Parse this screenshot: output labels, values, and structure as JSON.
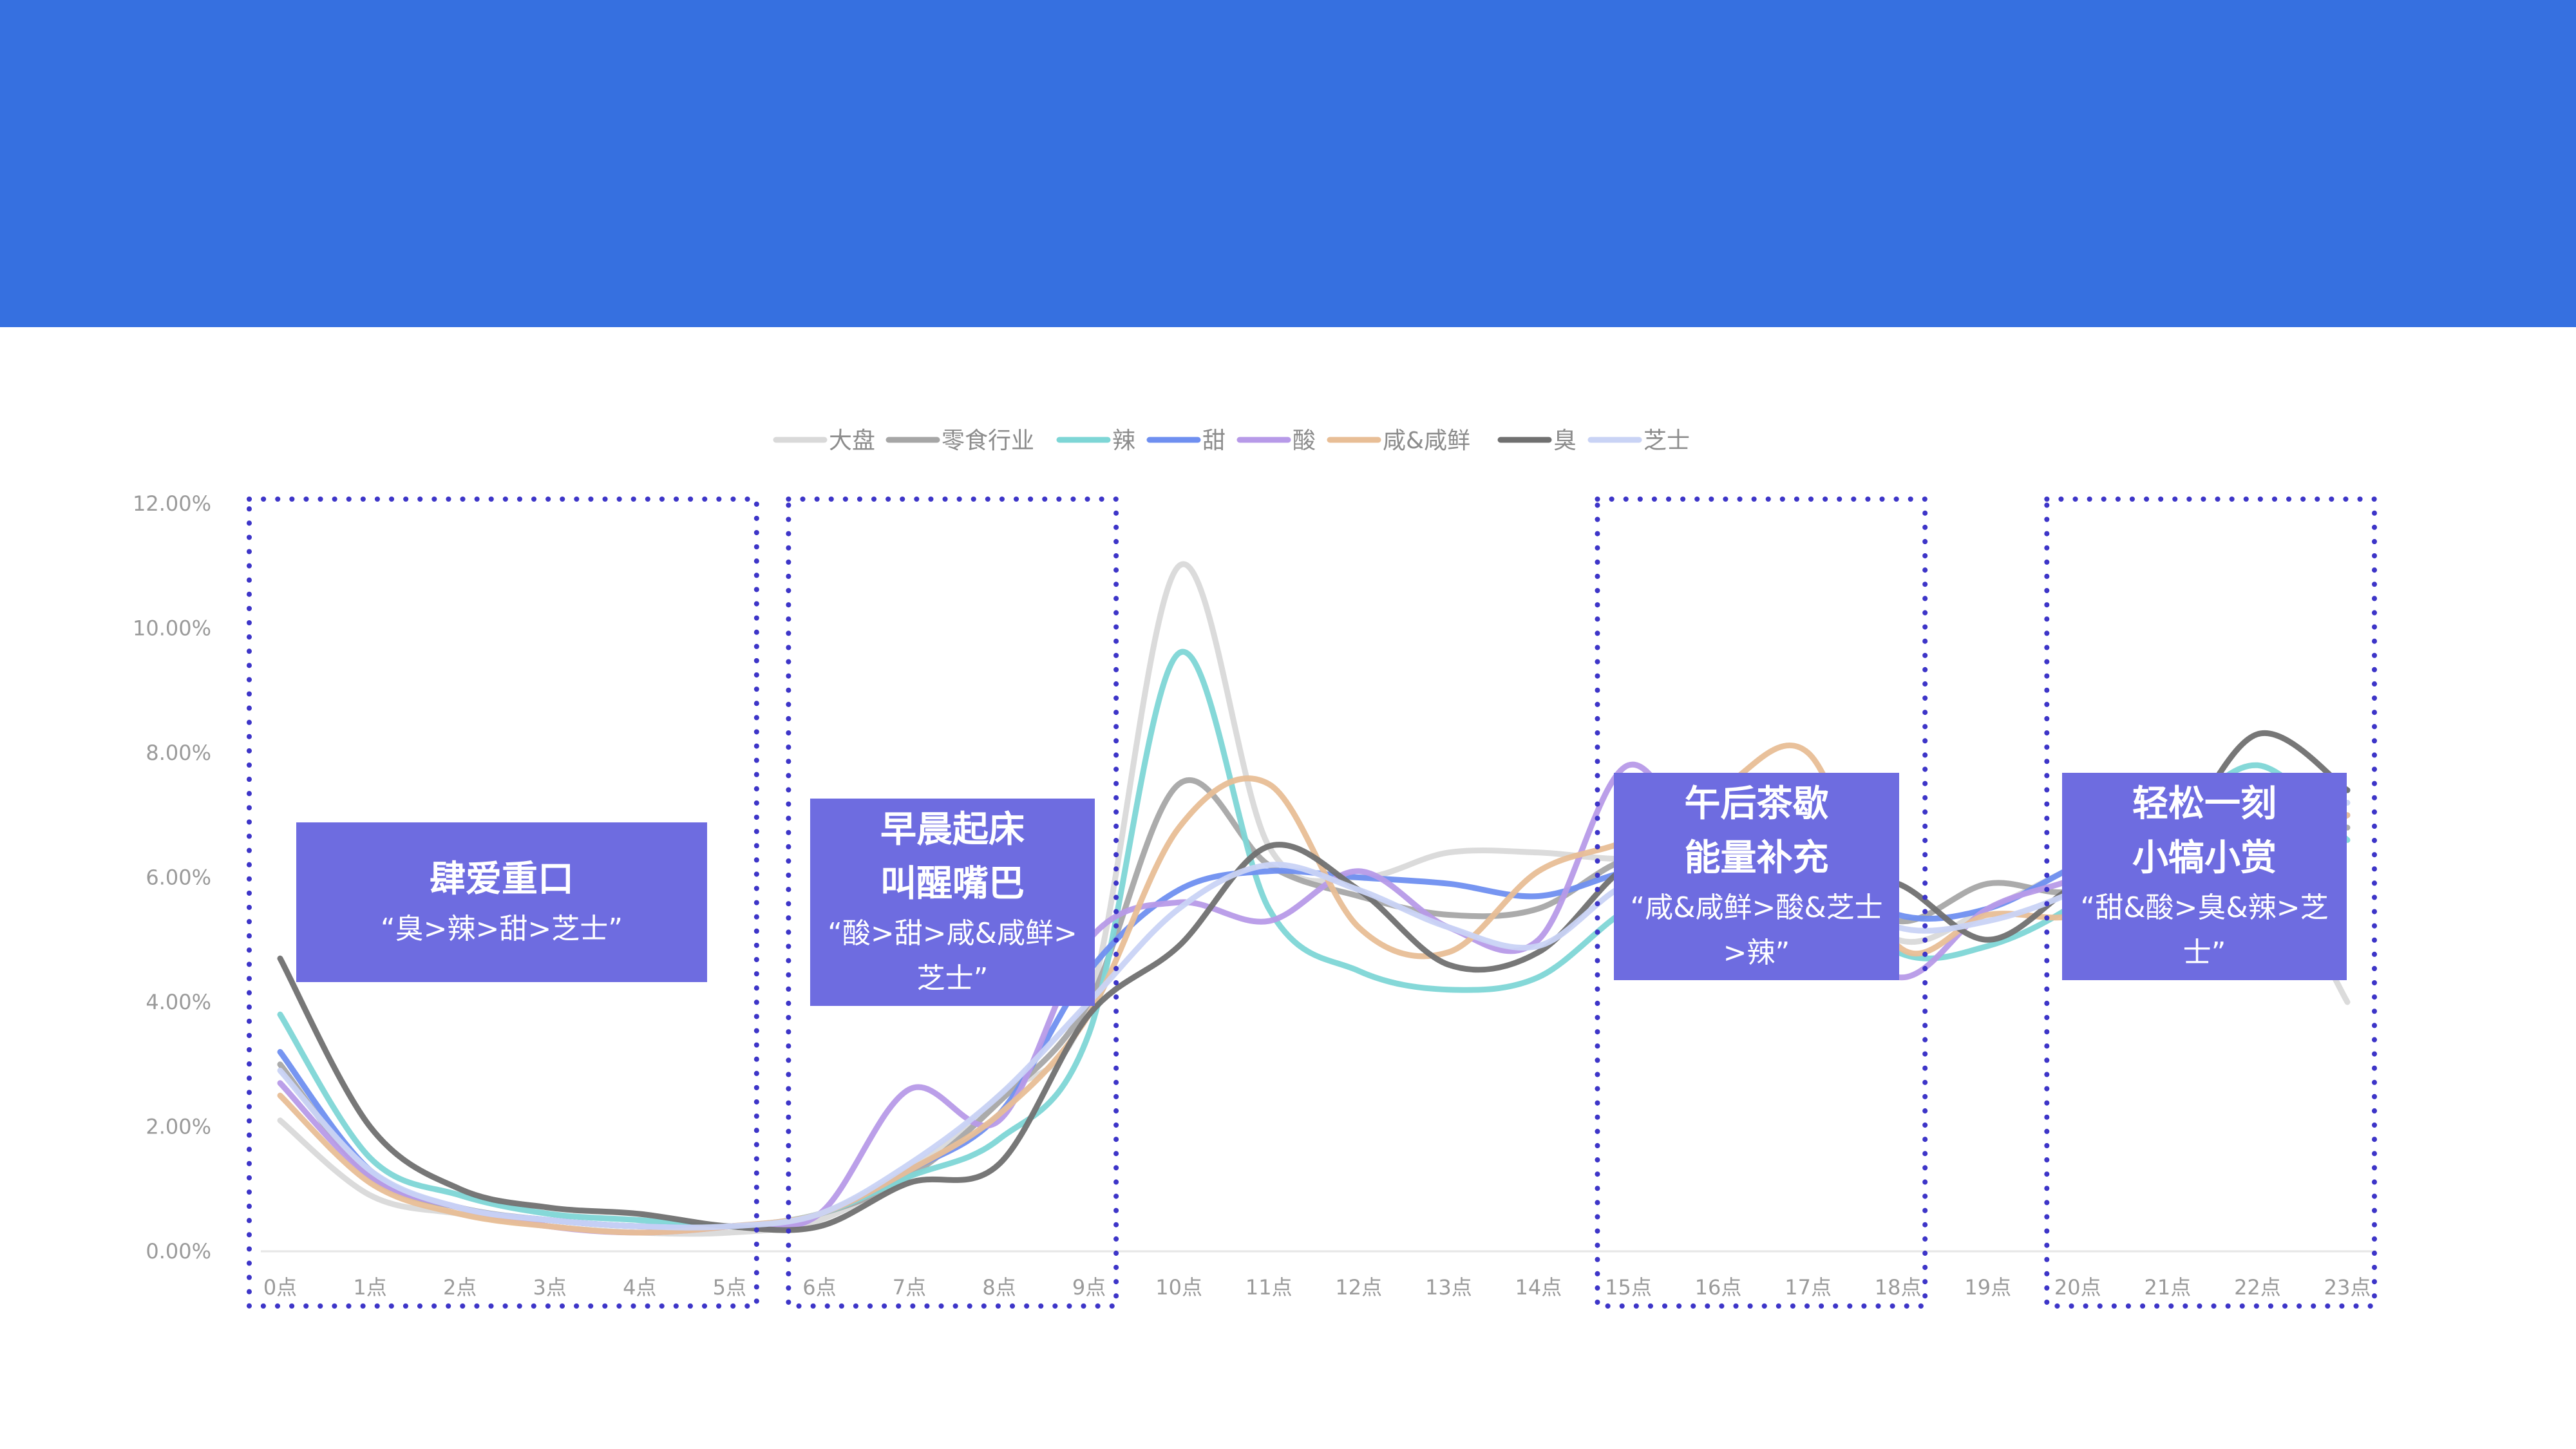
{
  "colors": {
    "header": "#3670E0",
    "callout_fill": "#6E6CE0",
    "dotted_box": "#3D35C8",
    "series": {
      "大盘": "#D9D9D9",
      "零食行业": "#A6A6A6",
      "辣": "#7ED6D6",
      "甜": "#6F8FF0",
      "酸": "#B79AE8",
      "咸&咸鲜": "#E8BE96",
      "臭": "#707070",
      "芝士": "#C9D3F5"
    }
  },
  "chart_data": {
    "type": "line",
    "title": "",
    "xlabel": "",
    "ylabel": "",
    "ylim": [
      0,
      0.12
    ],
    "y_ticks": [
      "0.00%",
      "2.00%",
      "4.00%",
      "6.00%",
      "8.00%",
      "10.00%",
      "12.00%"
    ],
    "categories": [
      "0点",
      "1点",
      "2点",
      "3点",
      "4点",
      "5点",
      "6点",
      "7点",
      "8点",
      "9点",
      "10点",
      "11点",
      "12点",
      "13点",
      "14点",
      "15点",
      "16点",
      "17点",
      "18点",
      "19点",
      "20点",
      "21点",
      "22点",
      "23点"
    ],
    "legend_position": "top",
    "grid": false,
    "series": [
      {
        "name": "大盘",
        "values": [
          0.021,
          0.009,
          0.006,
          0.004,
          0.003,
          0.003,
          0.005,
          0.013,
          0.025,
          0.04,
          0.11,
          0.065,
          0.06,
          0.064,
          0.064,
          0.063,
          0.065,
          0.065,
          0.05,
          0.055,
          0.062,
          0.069,
          0.065,
          0.04
        ]
      },
      {
        "name": "零食行业",
        "values": [
          0.03,
          0.012,
          0.007,
          0.005,
          0.004,
          0.004,
          0.006,
          0.012,
          0.024,
          0.04,
          0.075,
          0.062,
          0.057,
          0.054,
          0.055,
          0.063,
          0.063,
          0.063,
          0.053,
          0.059,
          0.058,
          0.068,
          0.069,
          0.068
        ]
      },
      {
        "name": "辣",
        "values": [
          0.038,
          0.015,
          0.009,
          0.006,
          0.005,
          0.004,
          0.006,
          0.012,
          0.018,
          0.035,
          0.096,
          0.055,
          0.045,
          0.042,
          0.044,
          0.055,
          0.061,
          0.062,
          0.048,
          0.049,
          0.056,
          0.068,
          0.078,
          0.066
        ]
      },
      {
        "name": "甜",
        "values": [
          0.032,
          0.013,
          0.007,
          0.005,
          0.004,
          0.004,
          0.006,
          0.013,
          0.022,
          0.045,
          0.058,
          0.061,
          0.06,
          0.059,
          0.057,
          0.061,
          0.063,
          0.063,
          0.054,
          0.055,
          0.062,
          0.068,
          0.071,
          0.074
        ]
      },
      {
        "name": "酸",
        "values": [
          0.027,
          0.012,
          0.007,
          0.004,
          0.003,
          0.004,
          0.006,
          0.026,
          0.021,
          0.05,
          0.056,
          0.053,
          0.061,
          0.052,
          0.05,
          0.078,
          0.06,
          0.06,
          0.044,
          0.055,
          0.06,
          0.067,
          0.07,
          0.07
        ]
      },
      {
        "name": "咸&咸鲜",
        "values": [
          0.025,
          0.011,
          0.006,
          0.004,
          0.003,
          0.004,
          0.006,
          0.013,
          0.022,
          0.038,
          0.068,
          0.075,
          0.052,
          0.048,
          0.061,
          0.066,
          0.074,
          0.08,
          0.049,
          0.054,
          0.054,
          0.062,
          0.062,
          0.07
        ]
      },
      {
        "name": "臭",
        "values": [
          0.047,
          0.02,
          0.01,
          0.007,
          0.006,
          0.004,
          0.004,
          0.011,
          0.014,
          0.038,
          0.049,
          0.065,
          0.058,
          0.046,
          0.048,
          0.062,
          0.066,
          0.061,
          0.059,
          0.05,
          0.059,
          0.065,
          0.083,
          0.074
        ]
      },
      {
        "name": "芝士",
        "values": [
          0.029,
          0.013,
          0.007,
          0.005,
          0.004,
          0.004,
          0.006,
          0.014,
          0.025,
          0.04,
          0.055,
          0.062,
          0.058,
          0.052,
          0.049,
          0.059,
          0.06,
          0.061,
          0.052,
          0.053,
          0.058,
          0.066,
          0.07,
          0.072
        ]
      }
    ]
  },
  "callouts": [
    {
      "title_lines": [
        "肆爱重口"
      ],
      "sub_lines": [
        "“臭>辣>甜>芝士”"
      ]
    },
    {
      "title_lines": [
        "早晨起床",
        "叫醒嘴巴"
      ],
      "sub_lines": [
        "“酸>甜>咸&咸鲜>",
        "芝士”"
      ]
    },
    {
      "title_lines": [
        "午后茶歇",
        "能量补充"
      ],
      "sub_lines": [
        "“咸&咸鲜>酸&芝士",
        ">辣”"
      ]
    },
    {
      "title_lines": [
        "轻松一刻",
        "小犒小赏"
      ],
      "sub_lines": [
        "“甜&酸>臭&辣>芝",
        "士”"
      ]
    }
  ],
  "highlight_ranges": [
    [
      0,
      5
    ],
    [
      6,
      9
    ],
    [
      15,
      18
    ],
    [
      20,
      23
    ]
  ]
}
